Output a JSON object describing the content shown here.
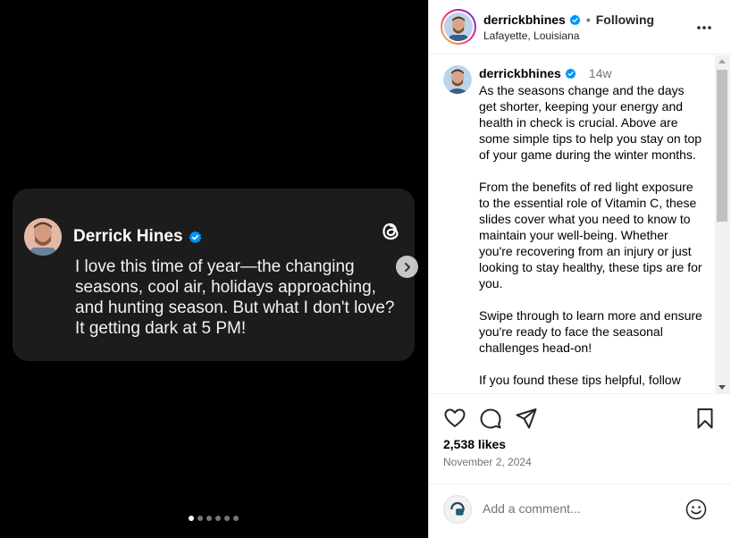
{
  "post": {
    "card": {
      "author_name": "Derrick Hines",
      "text": "I love this time of year—the changing seasons, cool air, holidays approaching, and hunting season. But what I don't love? It getting dark at 5 PM!"
    },
    "carousel": {
      "slide_count": 6,
      "active_index": 0
    }
  },
  "header": {
    "username": "derrickbhines",
    "separator": "•",
    "follow_status": "Following",
    "location": "Lafayette, Louisiana"
  },
  "caption": {
    "username": "derrickbhines",
    "time_ago": "14w",
    "text": "As the seasons change and the days get shorter, keeping your energy and health in check is crucial. Above are some simple tips to help you stay on top of your game during the winter months.\n\nFrom the benefits of red light exposure to the essential role of Vitamin C, these slides cover what you need to know to maintain your well-being. Whether you're recovering from an injury or just looking to stay healthy, these tips are for you.\n\nSwipe through to learn more and ensure you're ready to face the seasonal challenges head-on!\n\nIf you found these tips helpful, follow"
  },
  "actions": {
    "likes": "2,538 likes",
    "date": "November 2, 2024"
  },
  "comment": {
    "placeholder": "Add a comment..."
  },
  "colors": {
    "verified": "#0095f6",
    "media_bg": "#000000",
    "card_bg": "#1c1c1c"
  },
  "icons": [
    "verified-badge-icon",
    "threads-logo-icon",
    "chevron-right-icon",
    "more-options-icon",
    "heart-icon",
    "comment-icon",
    "share-icon",
    "bookmark-icon",
    "emoji-icon"
  ]
}
